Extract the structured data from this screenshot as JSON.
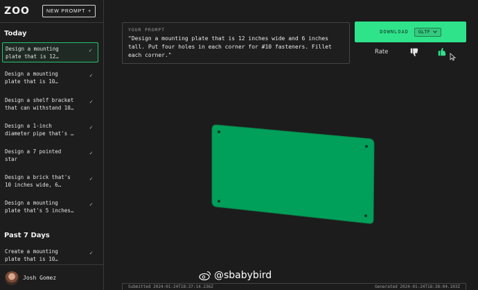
{
  "app": {
    "logo": "ZOO",
    "new_prompt_label": "NEW PROMPT",
    "new_prompt_icon": "plus-icon"
  },
  "sidebar": {
    "sections": [
      {
        "title": "Today",
        "items": [
          {
            "label": "Design a mounting\nplate that is 12…",
            "active": true
          },
          {
            "label": "Design a mounting\nplate that is 10…",
            "active": false
          },
          {
            "label": "Design a shelf bracket\nthat can withstand 10…",
            "active": false
          },
          {
            "label": "Design a 1-inch\ndiameter pipe that's …",
            "active": false
          },
          {
            "label": "Design a 7 pointed\nstar",
            "active": false
          },
          {
            "label": "Design a brick that's\n10 inches wide, 6…",
            "active": false
          },
          {
            "label": "Design a mounting\nplate that's 5 inches…",
            "active": false
          }
        ]
      },
      {
        "title": "Past 7 Days",
        "items": [
          {
            "label": "Create a mounting\nplate that is 10…",
            "active": false
          }
        ]
      }
    ],
    "check_glyph": "✓",
    "user": {
      "name": "Josh Gomez"
    }
  },
  "prompt": {
    "label": "YOUR PROMPT",
    "text": "\"Design a mounting plate that is 12 inches wide and 6 inches tall. Put four holes in each corner for #10 fasteners. Fillet each corner.\""
  },
  "download": {
    "label": "DOWNLOAD",
    "format": "GLTF",
    "format_icon": "chevron-down-icon"
  },
  "rating": {
    "label": "Rate",
    "thumbs_down_icon": "thumbs-down-icon",
    "thumbs_up_icon": "thumbs-up-icon"
  },
  "footer": {
    "submitted": "Submitted 2024-01-24T18:37:14.236Z",
    "generated": "Generated 2024-01-24T18:38:04.103Z"
  },
  "watermark": {
    "text": "@sbabybird"
  },
  "colors": {
    "accent": "#2fe38b",
    "plate": "#00a05a",
    "background": "#1c1c1c"
  }
}
